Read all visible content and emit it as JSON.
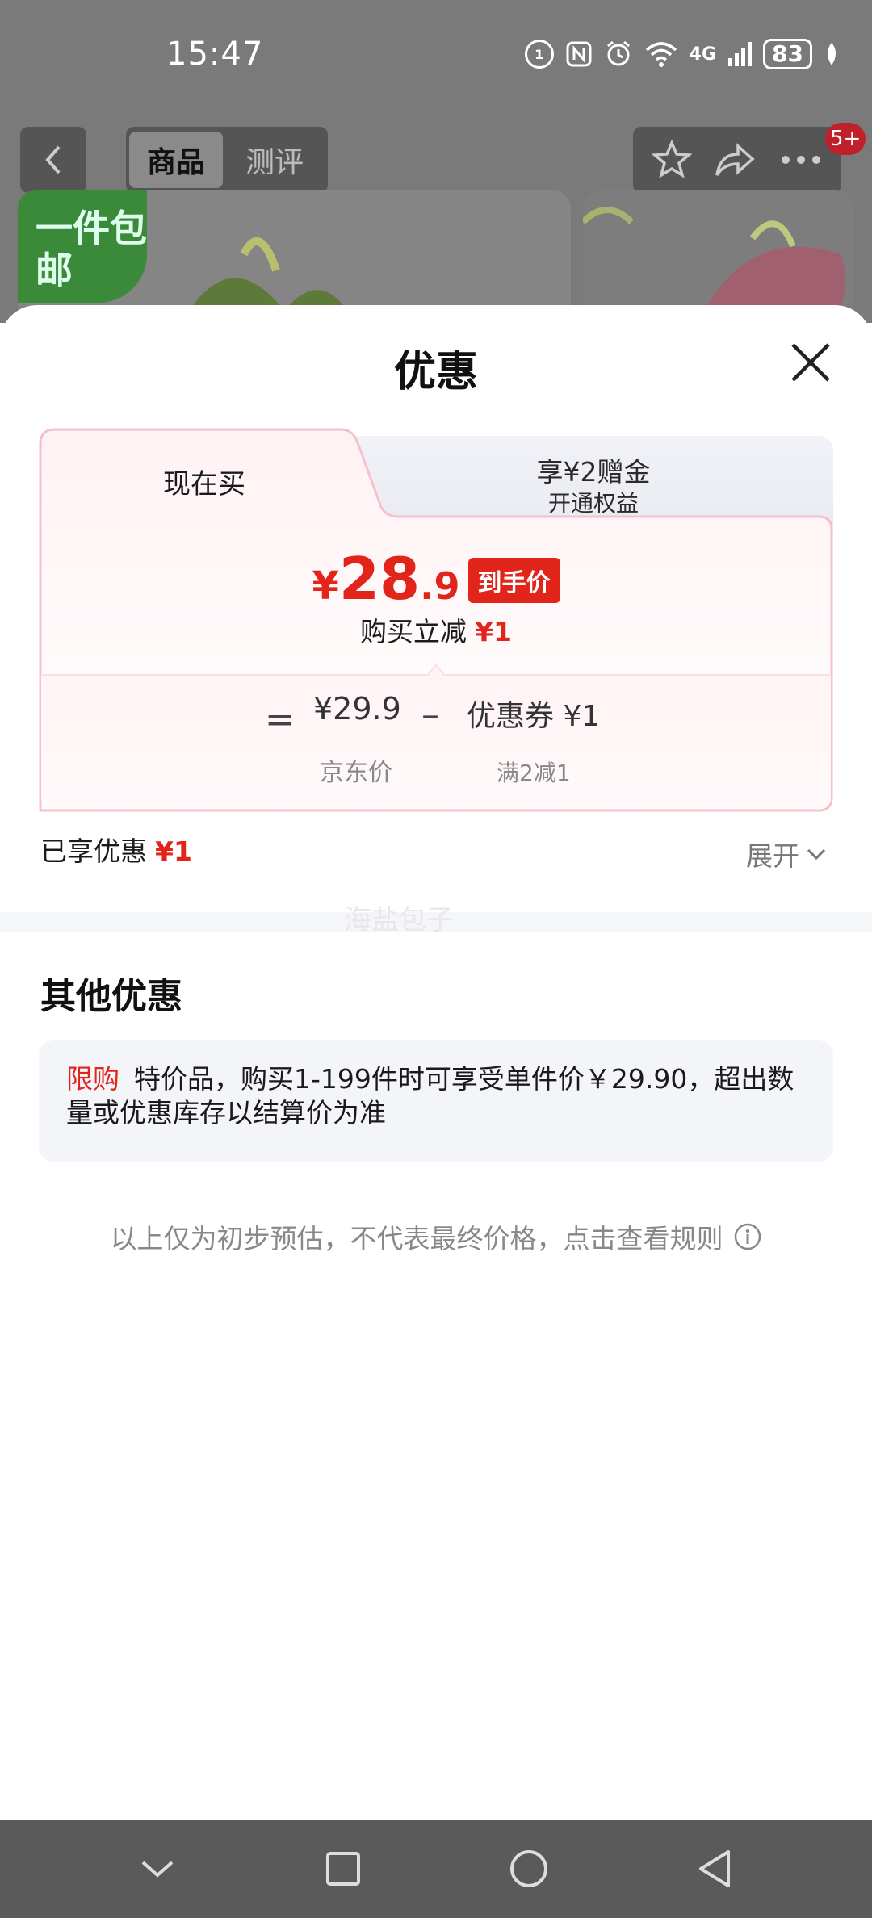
{
  "status_bar": {
    "time": "15:47",
    "icons": [
      "nfc-icon",
      "alarm-icon",
      "wifi-icon",
      "signal-icon"
    ],
    "network": "4G",
    "battery": "83"
  },
  "background_page": {
    "tabs": [
      {
        "label": "商品",
        "active": true
      },
      {
        "label": "测评",
        "active": false
      }
    ],
    "badge": "5+",
    "product_tag": "一件包邮"
  },
  "sheet": {
    "title": "优惠",
    "tab_now": "现在买",
    "tab_member_main": "享¥2赠金",
    "tab_member_sub": "开通权益",
    "price": {
      "symbol": "¥",
      "integer": "28",
      "decimal": ".9",
      "badge": "到手价"
    },
    "discount_line": {
      "label": "购买立减",
      "amount": "¥1"
    },
    "formula": {
      "eq": "=",
      "original_price": "¥29.9",
      "original_label": "京东价",
      "minus": "–",
      "coupon": "优惠券 ¥1",
      "coupon_rule": "满2减1"
    },
    "enjoyed": {
      "label": "已享优惠",
      "amount": "¥1"
    },
    "expand_label": "展开",
    "watermark": "海盐包子",
    "other_title": "其他优惠",
    "limit": {
      "tag": "限购",
      "text": "特价品，购买1-199件时可享受单件价￥29.90，超出数量或优惠库存以结算价为准"
    },
    "disclaimer": "以上仅为初步预估，不代表最终价格，点击查看规则"
  },
  "colors": {
    "accent_red": "#e1251b",
    "card_border": "#f7c6cf"
  }
}
